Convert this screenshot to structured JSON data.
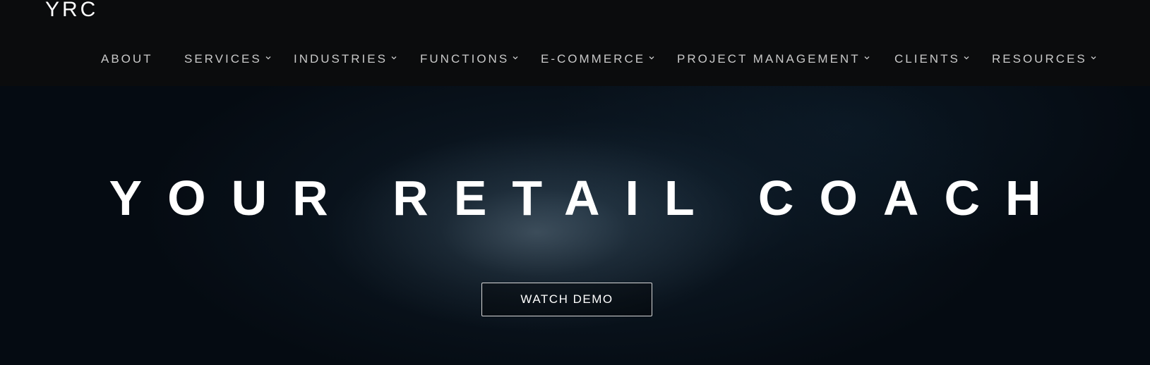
{
  "header": {
    "logo": "YRC"
  },
  "nav": {
    "items": [
      {
        "label": "ABOUT",
        "has_dropdown": false
      },
      {
        "label": "SERVICES",
        "has_dropdown": true
      },
      {
        "label": "INDUSTRIES",
        "has_dropdown": true
      },
      {
        "label": "FUNCTIONS",
        "has_dropdown": true
      },
      {
        "label": "E-COMMERCE",
        "has_dropdown": true
      },
      {
        "label": "PROJECT MANAGEMENT",
        "has_dropdown": true
      },
      {
        "label": "CLIENTS",
        "has_dropdown": true
      },
      {
        "label": "RESOURCES",
        "has_dropdown": true
      }
    ],
    "dropdown_icon": "chevron-down-icon"
  },
  "hero": {
    "title": "YOUR RETAIL COACH",
    "cta_label": "WATCH DEMO"
  },
  "colors": {
    "header_bg": "#0b0c0d",
    "hero_bg": "#050b12",
    "text": "#ffffff",
    "nav_text": "#c9c9c9"
  }
}
